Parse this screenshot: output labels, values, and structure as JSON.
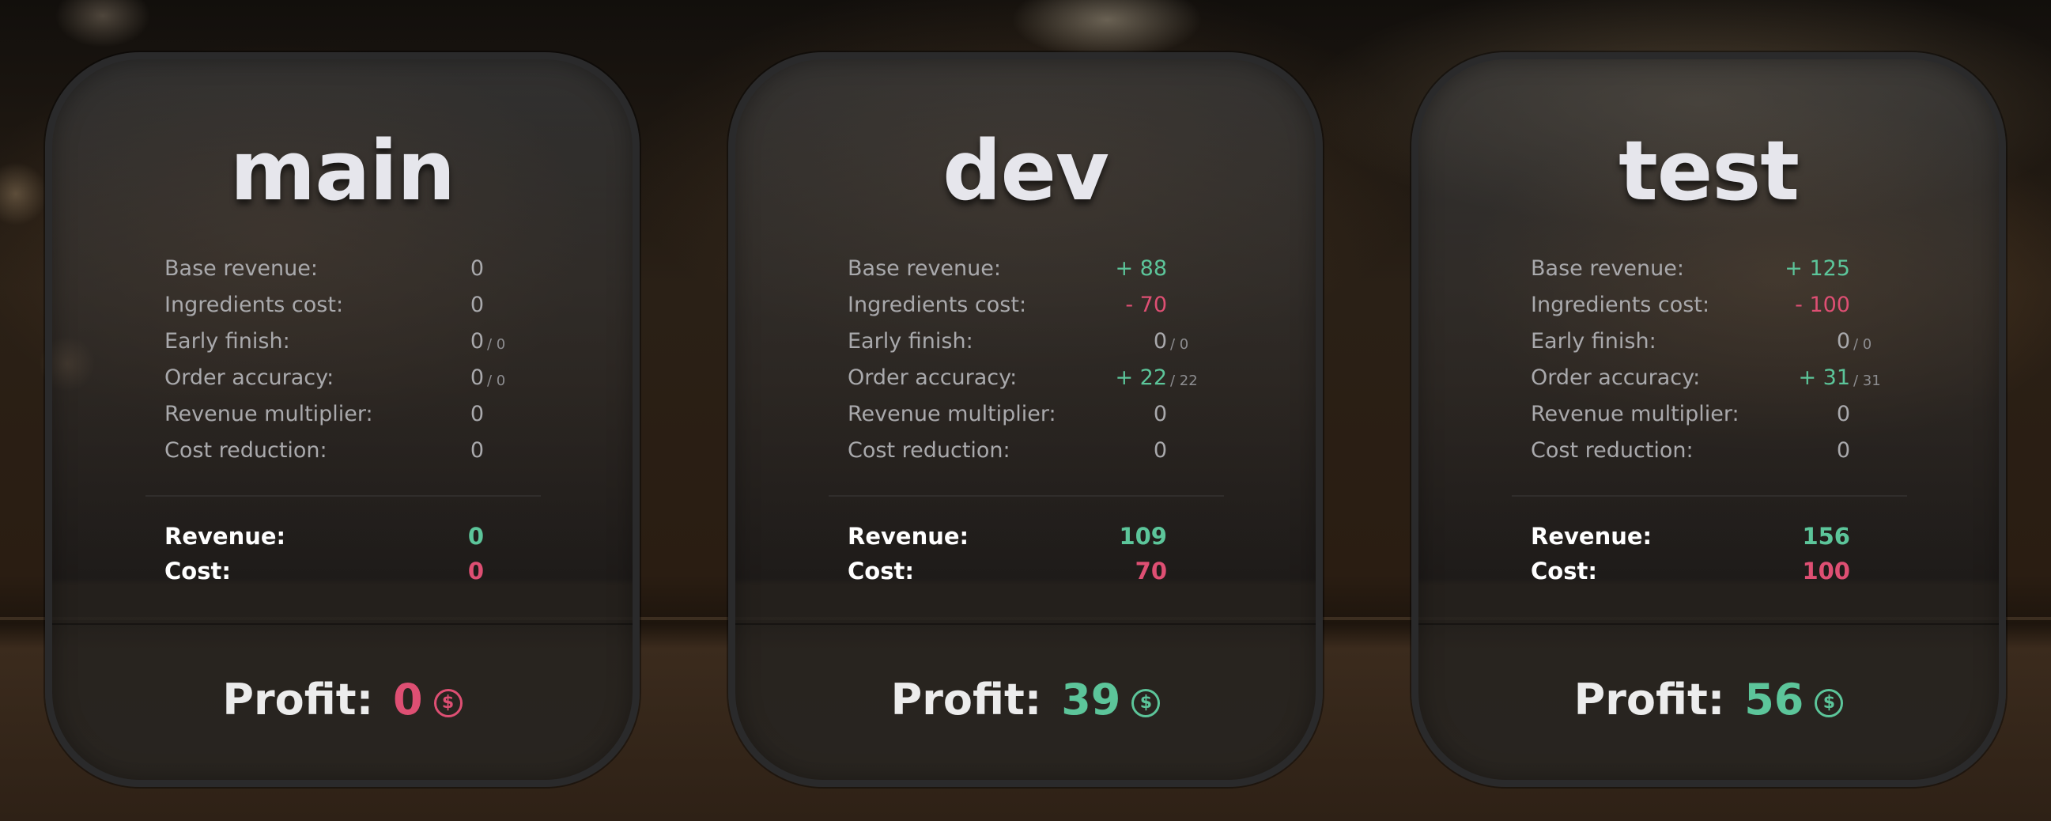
{
  "cards": [
    {
      "title": "main",
      "rows": [
        {
          "label": "Base revenue:",
          "value": "0",
          "sub": "",
          "tone": "neutral"
        },
        {
          "label": "Ingredients cost:",
          "value": "0",
          "sub": "",
          "tone": "neutral"
        },
        {
          "label": "Early finish:",
          "value": "0",
          "sub": "/ 0",
          "tone": "neutral"
        },
        {
          "label": "Order accuracy:",
          "value": "0",
          "sub": "/ 0",
          "tone": "neutral"
        },
        {
          "label": "Revenue multiplier:",
          "value": "0",
          "sub": "",
          "tone": "neutral"
        },
        {
          "label": "Cost reduction:",
          "value": "0",
          "sub": "",
          "tone": "neutral"
        }
      ],
      "revenue_label": "Revenue:",
      "revenue_value": "0",
      "cost_label": "Cost:",
      "cost_value": "0",
      "profit_label": "Profit:",
      "profit_value": "0",
      "profit_tone": "neg",
      "coin_icon": "$"
    },
    {
      "title": "dev",
      "rows": [
        {
          "label": "Base revenue:",
          "value": "+ 88",
          "sub": "",
          "tone": "pos"
        },
        {
          "label": "Ingredients cost:",
          "value": "- 70",
          "sub": "",
          "tone": "neg"
        },
        {
          "label": "Early finish:",
          "value": "0",
          "sub": "/ 0",
          "tone": "neutral"
        },
        {
          "label": "Order accuracy:",
          "value": "+ 22",
          "sub": "/ 22",
          "tone": "pos"
        },
        {
          "label": "Revenue multiplier:",
          "value": "0",
          "sub": "",
          "tone": "neutral"
        },
        {
          "label": "Cost reduction:",
          "value": "0",
          "sub": "",
          "tone": "neutral"
        }
      ],
      "revenue_label": "Revenue:",
      "revenue_value": "109",
      "cost_label": "Cost:",
      "cost_value": "70",
      "profit_label": "Profit:",
      "profit_value": "39",
      "profit_tone": "pos",
      "coin_icon": "$"
    },
    {
      "title": "test",
      "rows": [
        {
          "label": "Base revenue:",
          "value": "+ 125",
          "sub": "",
          "tone": "pos"
        },
        {
          "label": "Ingredients cost:",
          "value": "- 100",
          "sub": "",
          "tone": "neg"
        },
        {
          "label": "Early finish:",
          "value": "0",
          "sub": "/ 0",
          "tone": "neutral"
        },
        {
          "label": "Order accuracy:",
          "value": "+ 31",
          "sub": "/ 31",
          "tone": "pos"
        },
        {
          "label": "Revenue multiplier:",
          "value": "0",
          "sub": "",
          "tone": "neutral"
        },
        {
          "label": "Cost reduction:",
          "value": "0",
          "sub": "",
          "tone": "neutral"
        }
      ],
      "revenue_label": "Revenue:",
      "revenue_value": "156",
      "cost_label": "Cost:",
      "cost_value": "100",
      "profit_label": "Profit:",
      "profit_value": "56",
      "profit_tone": "pos",
      "coin_icon": "$"
    }
  ],
  "colors": {
    "positive": "#5cc59a",
    "negative": "#de4f73",
    "title": "#e6e6ec"
  }
}
